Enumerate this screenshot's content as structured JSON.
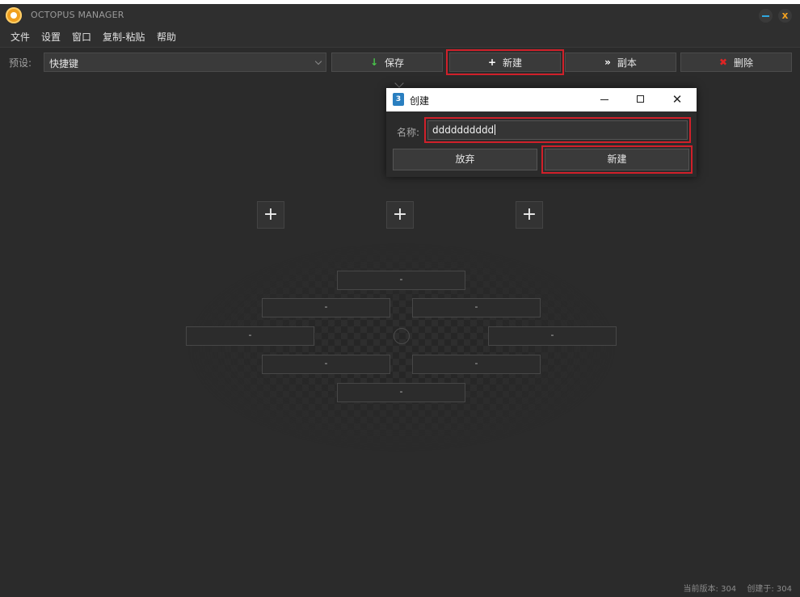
{
  "window": {
    "title": "OCTOPUS MANAGER",
    "minimize_icon": "minimize-icon",
    "close_glyph": "x"
  },
  "menu": {
    "items": [
      "文件",
      "设置",
      "窗口",
      "复制-粘贴",
      "帮助"
    ]
  },
  "toolbar": {
    "preset_label": "预设:",
    "preset_value": "快捷键",
    "save": {
      "icon": "↓",
      "label": "保存"
    },
    "new": {
      "icon": "+",
      "label": "新建"
    },
    "copy": {
      "icon": "»",
      "label": "副本"
    },
    "delete": {
      "icon": "✖",
      "label": "删除"
    }
  },
  "canvas": {
    "plus_glyph": "+",
    "slot_value": "-"
  },
  "dialog": {
    "title": "创建",
    "name_label": "名称:",
    "name_value": "dddddddddd",
    "cancel_label": "放弃",
    "create_label": "新建",
    "close_glyph": "✕"
  },
  "status": {
    "version": "当前版本: 304",
    "created_with": "创建于: 304"
  }
}
